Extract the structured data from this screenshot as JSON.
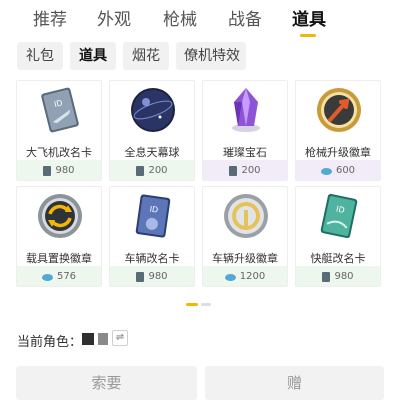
{
  "tabs": [
    {
      "label": "推荐",
      "active": false
    },
    {
      "label": "外观",
      "active": false
    },
    {
      "label": "枪械",
      "active": false
    },
    {
      "label": "战备",
      "active": false
    },
    {
      "label": "道具",
      "active": true
    }
  ],
  "subtabs": [
    {
      "label": "礼包",
      "active": false
    },
    {
      "label": "道具",
      "active": true
    },
    {
      "label": "烟花",
      "active": false
    },
    {
      "label": "僚机特效",
      "active": false
    }
  ],
  "items": [
    {
      "name": "大飞机改名卡",
      "price": "980",
      "currency": "card-icon"
    },
    {
      "name": "全息天幕球",
      "price": "200",
      "currency": "card-icon"
    },
    {
      "name": "璀璨宝石",
      "price": "200",
      "currency": "card-icon"
    },
    {
      "name": "枪械升级徽章",
      "price": "600",
      "currency": "gem-icon"
    },
    {
      "name": "载具置换徽章",
      "price": "576",
      "currency": "gem-icon"
    },
    {
      "name": "车辆改名卡",
      "price": "980",
      "currency": "card-icon"
    },
    {
      "name": "车辆升级徽章",
      "price": "1200",
      "currency": "gem-icon"
    },
    {
      "name": "快艇改名卡",
      "price": "980",
      "currency": "card-icon"
    }
  ],
  "pager": {
    "current": 1,
    "total": 2
  },
  "role": {
    "label": "当前角色：",
    "swap_icon": "swap-icon"
  },
  "buttons": {
    "request": "索要",
    "gift": "赠"
  },
  "colors": {
    "accent": "#f2b705",
    "price_green": "#eef7ee",
    "price_purple": "#f1ecf8"
  }
}
